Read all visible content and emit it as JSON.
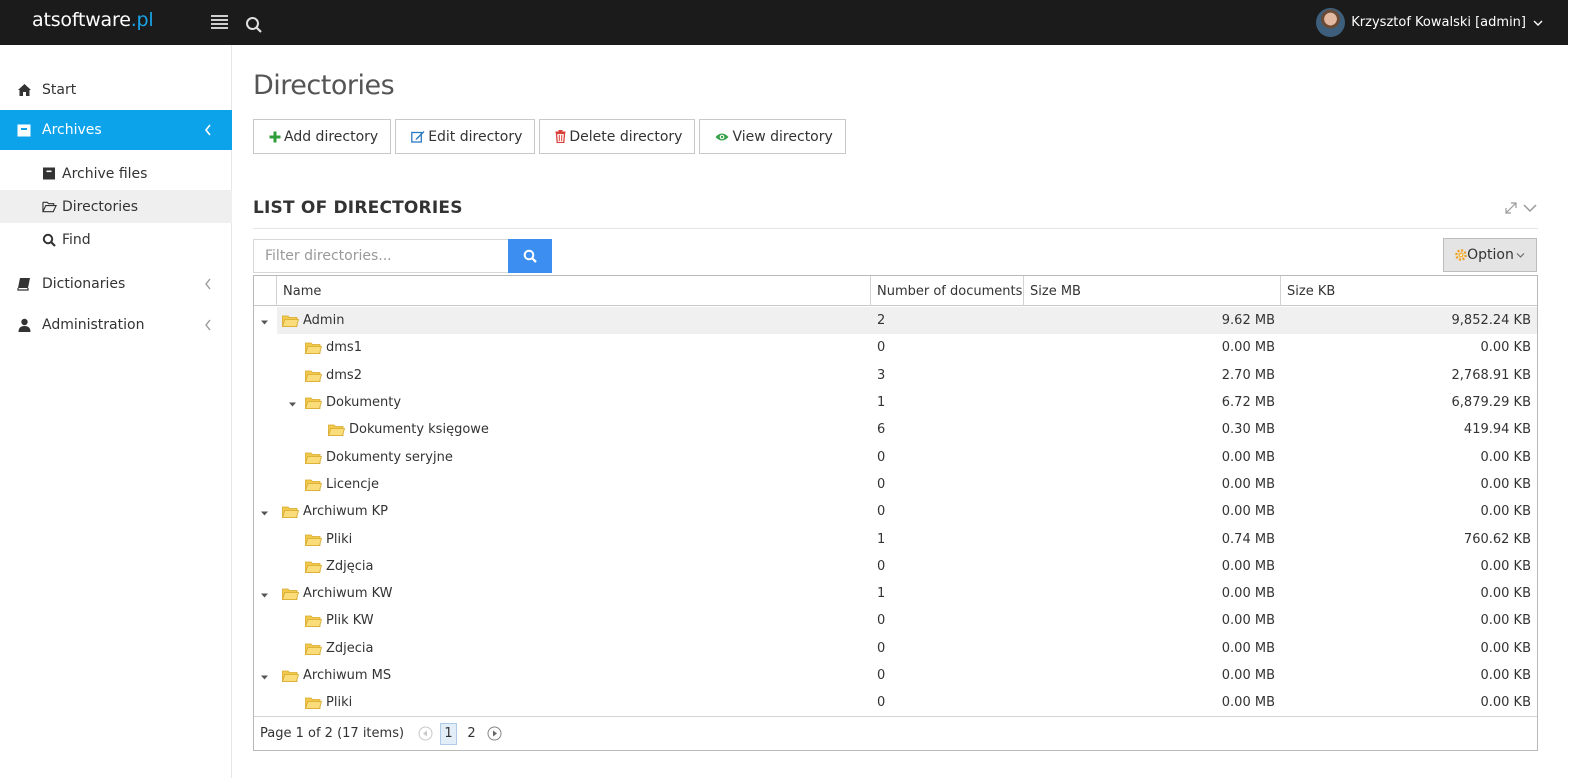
{
  "brand": {
    "name": "atsoftware",
    "tld": ".pl"
  },
  "user": {
    "name": "Krzysztof Kowalski [admin]"
  },
  "sidebar": {
    "items": [
      {
        "label": "Start",
        "icon": "home-icon"
      },
      {
        "label": "Archives",
        "icon": "archive-icon",
        "active": true
      },
      {
        "label": "Dictionaries",
        "icon": "book-icon"
      },
      {
        "label": "Administration",
        "icon": "user-icon"
      }
    ],
    "sub_items": [
      {
        "label": "Archive files",
        "icon": "archive-box-icon"
      },
      {
        "label": "Directories",
        "icon": "folder-open-icon",
        "selected": true
      },
      {
        "label": "Find",
        "icon": "search-icon"
      }
    ]
  },
  "page": {
    "title": "Directories"
  },
  "toolbar": {
    "add": "Add directory",
    "edit": "Edit directory",
    "delete": "Delete directory",
    "view": "View directory"
  },
  "section": {
    "title": "LIST OF DIRECTORIES"
  },
  "filter": {
    "placeholder": "Filter directories...",
    "option_label": "Option"
  },
  "grid": {
    "columns": [
      "Name",
      "Number of documents",
      "Size MB",
      "Size KB"
    ],
    "rows": [
      {
        "name": "Admin",
        "level": 0,
        "expanded": true,
        "docs": "2",
        "mb": "9.62 MB",
        "kb": "9,852.24 KB",
        "selected": true
      },
      {
        "name": "dms1",
        "level": 1,
        "docs": "0",
        "mb": "0.00 MB",
        "kb": "0.00 KB"
      },
      {
        "name": "dms2",
        "level": 1,
        "docs": "3",
        "mb": "2.70 MB",
        "kb": "2,768.91 KB"
      },
      {
        "name": "Dokumenty",
        "level": 1,
        "expanded": true,
        "docs": "1",
        "mb": "6.72 MB",
        "kb": "6,879.29 KB"
      },
      {
        "name": "Dokumenty księgowe",
        "level": 2,
        "docs": "6",
        "mb": "0.30 MB",
        "kb": "419.94 KB"
      },
      {
        "name": "Dokumenty seryjne",
        "level": 1,
        "docs": "0",
        "mb": "0.00 MB",
        "kb": "0.00 KB"
      },
      {
        "name": "Licencje",
        "level": 1,
        "docs": "0",
        "mb": "0.00 MB",
        "kb": "0.00 KB"
      },
      {
        "name": "Archiwum KP",
        "level": 0,
        "expanded": true,
        "docs": "0",
        "mb": "0.00 MB",
        "kb": "0.00 KB"
      },
      {
        "name": "Pliki",
        "level": 1,
        "docs": "1",
        "mb": "0.74 MB",
        "kb": "760.62 KB"
      },
      {
        "name": "Zdjęcia",
        "level": 1,
        "docs": "0",
        "mb": "0.00 MB",
        "kb": "0.00 KB"
      },
      {
        "name": "Archiwum KW",
        "level": 0,
        "expanded": true,
        "docs": "1",
        "mb": "0.00 MB",
        "kb": "0.00 KB"
      },
      {
        "name": "Plik KW",
        "level": 1,
        "docs": "0",
        "mb": "0.00 MB",
        "kb": "0.00 KB"
      },
      {
        "name": "Zdjecia",
        "level": 1,
        "docs": "0",
        "mb": "0.00 MB",
        "kb": "0.00 KB"
      },
      {
        "name": "Archiwum MS",
        "level": 0,
        "expanded": true,
        "docs": "0",
        "mb": "0.00 MB",
        "kb": "0.00 KB"
      },
      {
        "name": "Pliki",
        "level": 1,
        "docs": "0",
        "mb": "0.00 MB",
        "kb": "0.00 KB"
      }
    ]
  },
  "pager": {
    "info": "Page 1 of 2 (17 items)",
    "pages": [
      "1",
      "2"
    ],
    "current": "1"
  },
  "colors": {
    "brand_accent": "#1aa3e8",
    "active_nav": "#0da3ea",
    "search_button": "#3c8ef0",
    "topbar": "#1b1b1b"
  }
}
